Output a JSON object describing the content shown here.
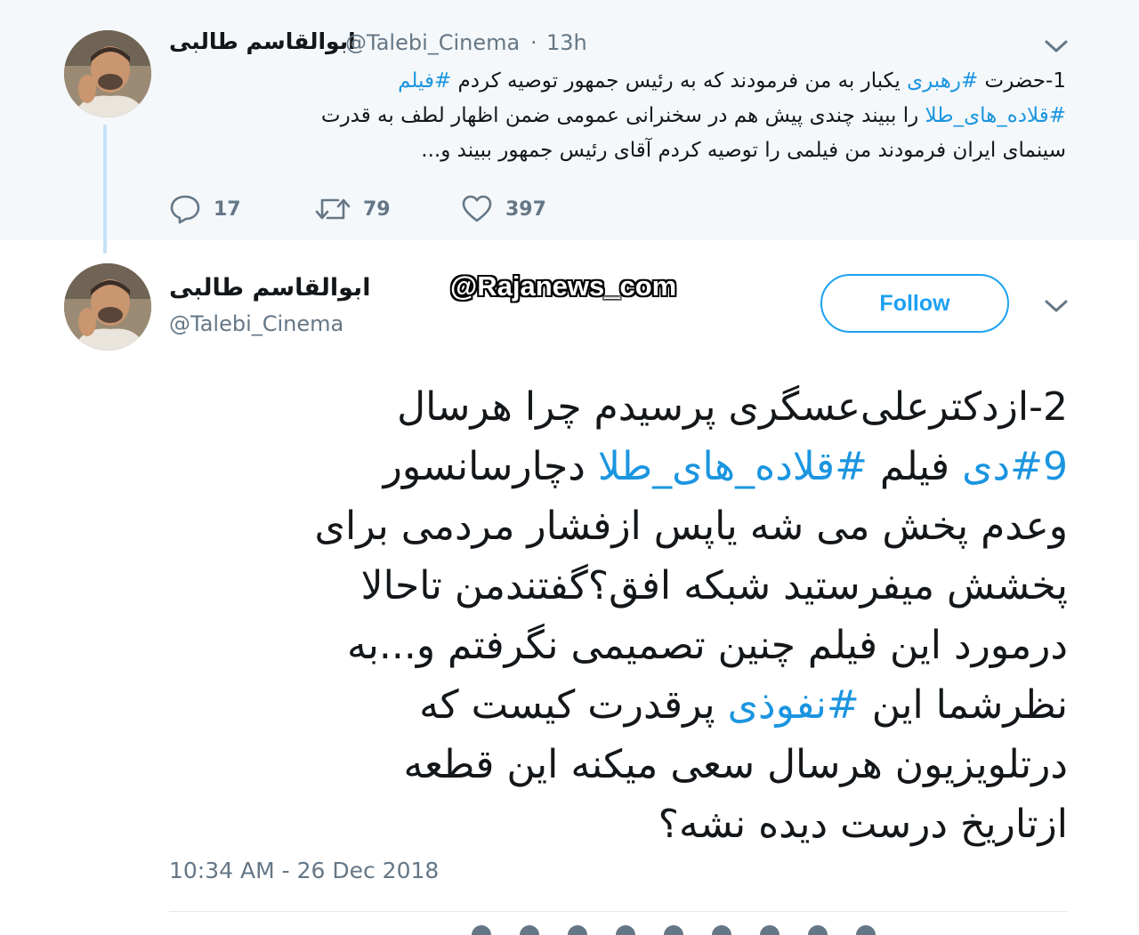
{
  "parent_tweet": {
    "author_name": "ابوالقاسم طالبی",
    "handle": "@Talebi_Cinema",
    "separator": "·",
    "time": "13h",
    "text_lines": [
      [
        {
          "t": "1-حضرت ",
          "h": false
        },
        {
          "t": "#رهبری",
          "h": true
        },
        {
          "t": " یکبار به من فرمودند که به رئیس جمهور توصیه کردم ",
          "h": false
        },
        {
          "t": "#فیلم",
          "h": true
        }
      ],
      [
        {
          "t": "#قلاده_های_طلا",
          "h": true
        },
        {
          "t": " را ببیند چندی پیش هم در سخنرانی عمومی ضمن اظهار لطف به قدرت",
          "h": false
        }
      ],
      [
        {
          "t": "سینمای ایران فرمودند من فیلمی را توصیه کردم آقای رئیس جمهور ببیند و...",
          "h": false
        }
      ]
    ],
    "reply_count": "17",
    "retweet_count": "79",
    "like_count": "397"
  },
  "main_tweet": {
    "author_name": "ابوالقاسم طالبی",
    "handle": "@Talebi_Cinema",
    "follow_label": "Follow",
    "watermark": "@Rajanews_com",
    "text_lines": [
      [
        {
          "t": "2-ازدکترعلی‌عسگری پرسیدم چرا هرسال",
          "h": false
        }
      ],
      [
        {
          "t": "#9دی",
          "h": true
        },
        {
          "t": " فیلم ",
          "h": false
        },
        {
          "t": "#قلاده_های_طلا",
          "h": true
        },
        {
          "t": " دچارسانسور",
          "h": false
        }
      ],
      [
        {
          "t": "وعدم پخش می شه یاپس ازفشار مردمی برای",
          "h": false
        }
      ],
      [
        {
          "t": "پخشش میفرستید شبکه افق؟گفتندمن تاحالا",
          "h": false
        }
      ],
      [
        {
          "t": "درمورد این فیلم چنین تصمیمی نگرفتم و...به",
          "h": false
        }
      ],
      [
        {
          "t": "نظرشما این ",
          "h": false
        },
        {
          "t": "#نفوذی",
          "h": true
        },
        {
          "t": " پرقدرت کیست که",
          "h": false
        }
      ],
      [
        {
          "t": "درتلویزیون هرسال سعی میکنه این قطعه",
          "h": false
        }
      ],
      [
        {
          "t": "ازتاریخ درست دیده نشه؟",
          "h": false
        }
      ]
    ],
    "timestamp": "10:34 AM - 26 Dec 2018"
  },
  "icons": {
    "reply": "reply-icon",
    "retweet": "retweet-icon",
    "like": "heart-icon",
    "more": "chevron-down-icon"
  },
  "colors": {
    "accent": "#1da1f2",
    "hashtag": "#1b95e0",
    "muted": "#657786",
    "parent_bg": "#f5f8fa",
    "thread_line": "#c4e2f7"
  }
}
